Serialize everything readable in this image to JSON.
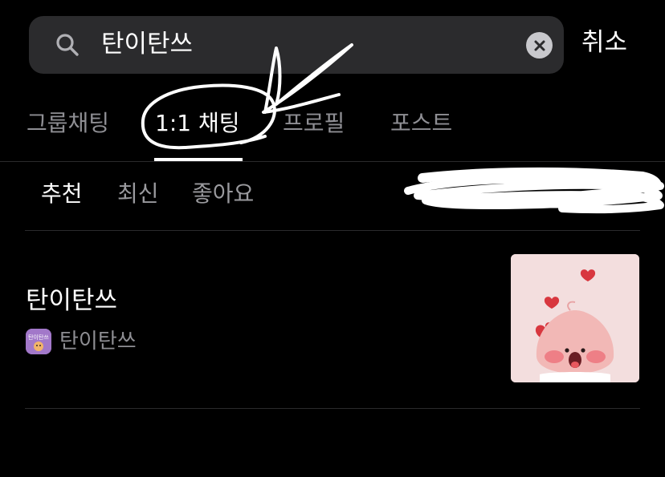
{
  "search": {
    "query": "탄이탄쓰",
    "cancel_label": "취소"
  },
  "tabs": [
    {
      "label": "그룹채팅",
      "active": false
    },
    {
      "label": "1:1 채팅",
      "active": true
    },
    {
      "label": "프로필",
      "active": false
    },
    {
      "label": "포스트",
      "active": false
    }
  ],
  "sort": {
    "options": [
      {
        "label": "추천",
        "active": true
      },
      {
        "label": "최신",
        "active": false
      },
      {
        "label": "좋아요",
        "active": false
      }
    ]
  },
  "results": [
    {
      "title": "탄이탄쓰",
      "owner_name": "탄이탄쓰",
      "avatar_text": "탄이탄쓰"
    }
  ],
  "colors": {
    "background": "#000000",
    "search_bg": "#2b2b2d",
    "inactive_text": "#8e8e93",
    "active_text": "#ffffff",
    "thumbnail_bg": "#f3dede",
    "heart": "#d8373f",
    "avatar_bg": "#a278c9"
  },
  "icons": {
    "search": "search-icon",
    "clear": "clear-icon",
    "filter": "chevron-down-icon"
  }
}
